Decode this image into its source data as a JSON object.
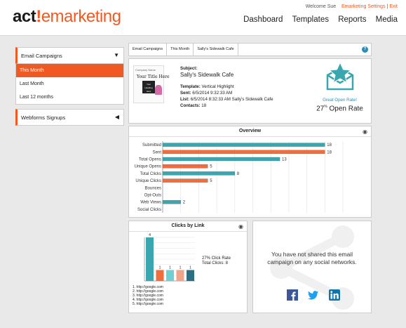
{
  "header": {
    "logo_act": "act",
    "logo_bang": "!",
    "logo_rest": "emarketing",
    "welcome": "Welcome Sue",
    "settings_link": "Emarketing Settings",
    "separator": "|",
    "exit_link": "Exit",
    "nav": [
      "Dashboard",
      "Templates",
      "Reports",
      "Media"
    ]
  },
  "sidebar": {
    "campaigns_label": "Email Campaigns",
    "items": [
      "This Month",
      "Last Month",
      "Last 12 months"
    ],
    "active_item": "This Month",
    "webforms_label": "Webforms Signups"
  },
  "breadcrumb": [
    "Email Campaigns",
    "This Month",
    "Sally's Sidewalk Cafe"
  ],
  "campaign": {
    "thumb_company": "Company Name",
    "thumb_title": "Your Title Here",
    "thumb_heading": "Your Heading Here",
    "subject_label": "Subject:",
    "subject": "Sally's Sidewalk Cafe",
    "template_label": "Template:",
    "template": "Vertical Highlight",
    "sent_label": "Sent:",
    "sent": "6/5/2014 9:32:33 AM",
    "list_label": "List:",
    "list": "6/5/2014 8:32:33 AM Sally's Sidewalk Cafe",
    "contacts_label": "Contacts:",
    "contacts": "18",
    "great_rate": "Great Open Rate!",
    "open_rate_value": "27",
    "open_rate_unit": "%",
    "open_rate_label": "Open Rate"
  },
  "overview_title": "Overview",
  "clicks_title": "Clicks by Link",
  "clicks_stats": {
    "rate": "27% Click Rate",
    "total": "Total Clicks: 8"
  },
  "links": [
    "1. http://google.com",
    "2. http://google.com",
    "3. http://google.com",
    "4. http://google.com",
    "5. http://google.com"
  ],
  "share_message": "You have not shared this email campaign on any social networks.",
  "colors": {
    "accent": "#f05a22",
    "teal": "#3aa6b0",
    "blue": "#2b8fb4"
  },
  "chart_data": [
    {
      "type": "bar",
      "orientation": "horizontal",
      "title": "Overview",
      "categories": [
        "Submitted",
        "Sent",
        "Total Opens",
        "Unique Opens",
        "Total Clicks",
        "Unique Clicks",
        "Bounces",
        "Opt-Outs",
        "Web Views",
        "Social Clicks"
      ],
      "values": [
        18,
        18,
        13,
        5,
        8,
        5,
        0,
        0,
        2,
        0
      ],
      "value_labels": [
        "18",
        "18",
        "13",
        "5",
        "8",
        "5",
        "",
        "",
        "2",
        ""
      ],
      "bar_colors": [
        "#3aa6b0",
        "#f26d3d",
        "#3aa6b0",
        "#f26d3d",
        "#3aa6b0",
        "#f26d3d",
        "#3aa6b0",
        "#f26d3d",
        "#3aa6b0",
        "#f26d3d"
      ],
      "xlim": [
        0,
        20
      ],
      "grid": true
    },
    {
      "type": "bar",
      "title": "Clicks by Link",
      "categories": [
        "1",
        "2",
        "3",
        "4",
        "5"
      ],
      "values": [
        4,
        1,
        1,
        1,
        1
      ],
      "value_labels": [
        "4",
        "1",
        "1",
        "1",
        "1"
      ],
      "bar_colors": [
        "#3aa6b0",
        "#f26d3d",
        "#6fd0d2",
        "#f2a48a",
        "#2d6f82"
      ],
      "ylim": [
        0,
        4
      ],
      "grid": true
    }
  ]
}
